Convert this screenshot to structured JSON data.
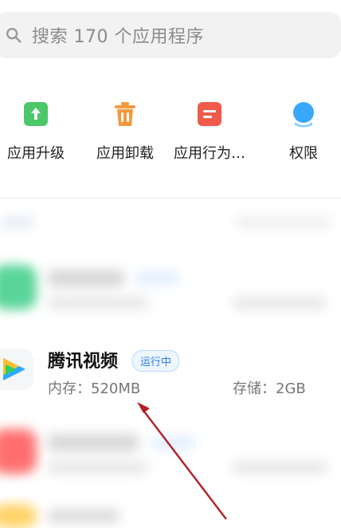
{
  "search": {
    "placeholder": "搜索 170 个应用程序",
    "icon": "search-icon"
  },
  "tools": [
    {
      "label": "应用升级",
      "icon": "upgrade-icon",
      "color": "#4cc86a"
    },
    {
      "label": "应用卸载",
      "icon": "trash-icon",
      "color": "#f39a3d"
    },
    {
      "label": "应用行为…",
      "icon": "behavior-record-icon",
      "color": "#f05a4a"
    },
    {
      "label": "权限",
      "icon": "permission-icon",
      "color": "#3aa7ff"
    }
  ],
  "app": {
    "name": "腾讯视频",
    "status": "运行中",
    "memory": "内存：520MB",
    "storage": "存储：2GB",
    "icon": "tencent-video-icon"
  }
}
